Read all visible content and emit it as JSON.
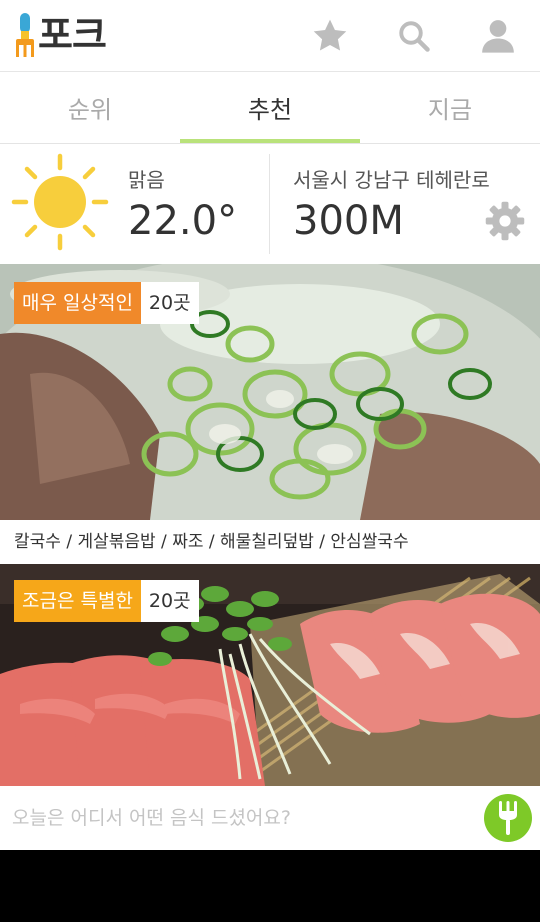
{
  "app": {
    "title": "포크",
    "header_icons": [
      "star-icon",
      "search-icon",
      "user-icon"
    ]
  },
  "tabs": [
    {
      "label": "순위",
      "active": false
    },
    {
      "label": "추천",
      "active": true
    },
    {
      "label": "지금",
      "active": false
    }
  ],
  "weather": {
    "condition": "맑음",
    "temperature": "22.0°",
    "address": "서울시 강남구 테헤란로",
    "distance": "300M",
    "icon": "sun-icon"
  },
  "cards": [
    {
      "badge_label": "매우 일상적인",
      "badge_count": "20곳",
      "badge_color": "#f0892a",
      "menu_items": "칼국수 / 게살볶음밥 / 짜조 / 해물칠리덮밥 / 안심쌀국수"
    },
    {
      "badge_label": "조금은 특별한",
      "badge_count": "20곳",
      "badge_color": "#f6a719"
    }
  ],
  "bottom": {
    "placeholder": "오늘은 어디서 어떤 음식 드셨어요?",
    "fab_icon": "fork-icon"
  },
  "colors": {
    "accent_green": "#b9e27a",
    "fab_green": "#7ec928",
    "sun_yellow": "#f7ce3c"
  }
}
